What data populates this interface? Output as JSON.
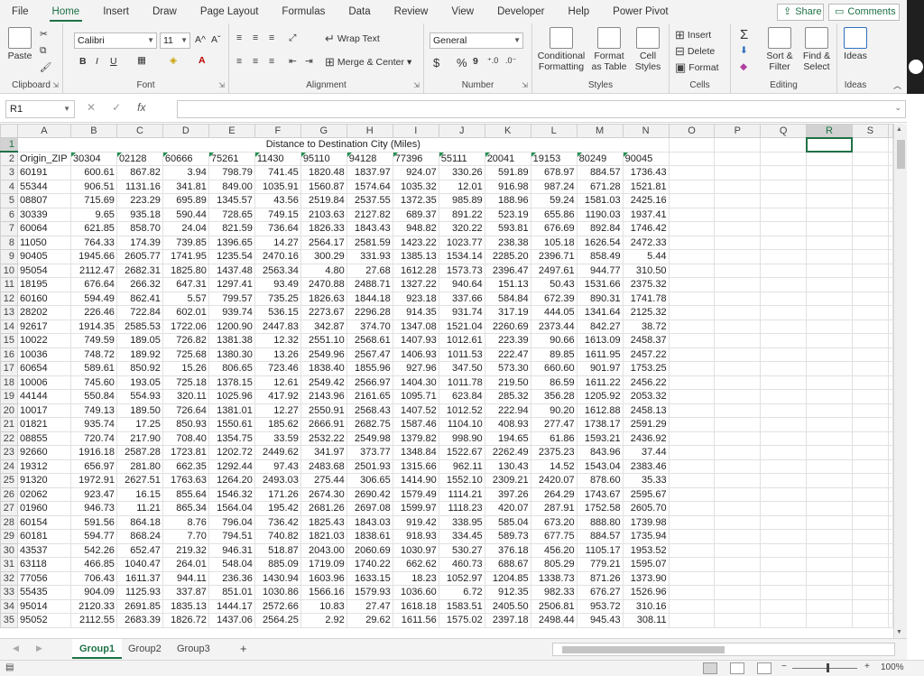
{
  "menu_tabs": [
    "File",
    "Home",
    "Insert",
    "Draw",
    "Page Layout",
    "Formulas",
    "Data",
    "Review",
    "View",
    "Developer",
    "Help",
    "Power Pivot"
  ],
  "share_label": "Share",
  "comments_label": "Comments",
  "ribbon": {
    "clipboard": {
      "label": "Clipboard",
      "paste": "Paste"
    },
    "font": {
      "label": "Font",
      "name": "Calibri",
      "size": "11",
      "grow": "A^",
      "shrink": "Aˇ",
      "bold": "B",
      "italic": "I",
      "underline": "U"
    },
    "alignment": {
      "label": "Alignment",
      "wrap": "Wrap Text",
      "merge": "Merge & Center"
    },
    "number": {
      "label": "Number",
      "format": "General",
      "currency": "$",
      "percent": "%",
      "comma": "9"
    },
    "styles": {
      "label": "Styles",
      "cond": "Conditional Formatting",
      "table": "Format as Table",
      "cell": "Cell Styles"
    },
    "cells": {
      "label": "Cells",
      "insert": "Insert",
      "delete": "Delete",
      "format": "Format"
    },
    "editing": {
      "label": "Editing",
      "sortfilter": "Sort & Filter",
      "findselect": "Find & Select",
      "sum": "Σ"
    },
    "ideas": {
      "label": "Ideas",
      "btn": "Ideas"
    }
  },
  "formula_bar": {
    "name_box": "R1",
    "cancel": "✕",
    "enter": "✓",
    "fx": "fx",
    "value": ""
  },
  "columns": [
    "A",
    "B",
    "C",
    "D",
    "E",
    "F",
    "G",
    "H",
    "I",
    "J",
    "K",
    "L",
    "M",
    "N",
    "O",
    "P",
    "Q",
    "R",
    "S"
  ],
  "selected_column": "R",
  "selected_row": 1,
  "title_cell": "Distance to Destination City (Miles)",
  "header_row": [
    "Origin_ZIP",
    "30304",
    "02128",
    "60666",
    "75261",
    "11430",
    "95110",
    "94128",
    "77396",
    "55111",
    "20041",
    "19153",
    "80249",
    "90045"
  ],
  "rows": [
    [
      "60191",
      "600.61",
      "867.82",
      "3.94",
      "798.79",
      "741.45",
      "1820.48",
      "1837.97",
      "924.07",
      "330.26",
      "591.89",
      "678.97",
      "884.57",
      "1736.43"
    ],
    [
      "55344",
      "906.51",
      "1131.16",
      "341.81",
      "849.00",
      "1035.91",
      "1560.87",
      "1574.64",
      "1035.32",
      "12.01",
      "916.98",
      "987.24",
      "671.28",
      "1521.81"
    ],
    [
      "08807",
      "715.69",
      "223.29",
      "695.89",
      "1345.57",
      "43.56",
      "2519.84",
      "2537.55",
      "1372.35",
      "985.89",
      "188.96",
      "59.24",
      "1581.03",
      "2425.16"
    ],
    [
      "30339",
      "9.65",
      "935.18",
      "590.44",
      "728.65",
      "749.15",
      "2103.63",
      "2127.82",
      "689.37",
      "891.22",
      "523.19",
      "655.86",
      "1190.03",
      "1937.41"
    ],
    [
      "60064",
      "621.85",
      "858.70",
      "24.04",
      "821.59",
      "736.64",
      "1826.33",
      "1843.43",
      "948.82",
      "320.22",
      "593.81",
      "676.69",
      "892.84",
      "1746.42"
    ],
    [
      "11050",
      "764.33",
      "174.39",
      "739.85",
      "1396.65",
      "14.27",
      "2564.17",
      "2581.59",
      "1423.22",
      "1023.77",
      "238.38",
      "105.18",
      "1626.54",
      "2472.33"
    ],
    [
      "90405",
      "1945.66",
      "2605.77",
      "1741.95",
      "1235.54",
      "2470.16",
      "300.29",
      "331.93",
      "1385.13",
      "1534.14",
      "2285.20",
      "2396.71",
      "858.49",
      "5.44"
    ],
    [
      "95054",
      "2112.47",
      "2682.31",
      "1825.80",
      "1437.48",
      "2563.34",
      "4.80",
      "27.68",
      "1612.28",
      "1573.73",
      "2396.47",
      "2497.61",
      "944.77",
      "310.50"
    ],
    [
      "18195",
      "676.64",
      "266.32",
      "647.31",
      "1297.41",
      "93.49",
      "2470.88",
      "2488.71",
      "1327.22",
      "940.64",
      "151.13",
      "50.43",
      "1531.66",
      "2375.32"
    ],
    [
      "60160",
      "594.49",
      "862.41",
      "5.57",
      "799.57",
      "735.25",
      "1826.63",
      "1844.18",
      "923.18",
      "337.66",
      "584.84",
      "672.39",
      "890.31",
      "1741.78"
    ],
    [
      "28202",
      "226.46",
      "722.84",
      "602.01",
      "939.74",
      "536.15",
      "2273.67",
      "2296.28",
      "914.35",
      "931.74",
      "317.19",
      "444.05",
      "1341.64",
      "2125.32"
    ],
    [
      "92617",
      "1914.35",
      "2585.53",
      "1722.06",
      "1200.90",
      "2447.83",
      "342.87",
      "374.70",
      "1347.08",
      "1521.04",
      "2260.69",
      "2373.44",
      "842.27",
      "38.72"
    ],
    [
      "10022",
      "749.59",
      "189.05",
      "726.82",
      "1381.38",
      "12.32",
      "2551.10",
      "2568.61",
      "1407.93",
      "1012.61",
      "223.39",
      "90.66",
      "1613.09",
      "2458.37"
    ],
    [
      "10036",
      "748.72",
      "189.92",
      "725.68",
      "1380.30",
      "13.26",
      "2549.96",
      "2567.47",
      "1406.93",
      "1011.53",
      "222.47",
      "89.85",
      "1611.95",
      "2457.22"
    ],
    [
      "60654",
      "589.61",
      "850.92",
      "15.26",
      "806.65",
      "723.46",
      "1838.40",
      "1855.96",
      "927.96",
      "347.50",
      "573.30",
      "660.60",
      "901.97",
      "1753.25"
    ],
    [
      "10006",
      "745.60",
      "193.05",
      "725.18",
      "1378.15",
      "12.61",
      "2549.42",
      "2566.97",
      "1404.30",
      "1011.78",
      "219.50",
      "86.59",
      "1611.22",
      "2456.22"
    ],
    [
      "44144",
      "550.84",
      "554.93",
      "320.11",
      "1025.96",
      "417.92",
      "2143.96",
      "2161.65",
      "1095.71",
      "623.84",
      "285.32",
      "356.28",
      "1205.92",
      "2053.32"
    ],
    [
      "10017",
      "749.13",
      "189.50",
      "726.64",
      "1381.01",
      "12.27",
      "2550.91",
      "2568.43",
      "1407.52",
      "1012.52",
      "222.94",
      "90.20",
      "1612.88",
      "2458.13"
    ],
    [
      "01821",
      "935.74",
      "17.25",
      "850.93",
      "1550.61",
      "185.62",
      "2666.91",
      "2682.75",
      "1587.46",
      "1104.10",
      "408.93",
      "277.47",
      "1738.17",
      "2591.29"
    ],
    [
      "08855",
      "720.74",
      "217.90",
      "708.40",
      "1354.75",
      "33.59",
      "2532.22",
      "2549.98",
      "1379.82",
      "998.90",
      "194.65",
      "61.86",
      "1593.21",
      "2436.92"
    ],
    [
      "92660",
      "1916.18",
      "2587.28",
      "1723.81",
      "1202.72",
      "2449.62",
      "341.97",
      "373.77",
      "1348.84",
      "1522.67",
      "2262.49",
      "2375.23",
      "843.96",
      "37.44"
    ],
    [
      "19312",
      "656.97",
      "281.80",
      "662.35",
      "1292.44",
      "97.43",
      "2483.68",
      "2501.93",
      "1315.66",
      "962.11",
      "130.43",
      "14.52",
      "1543.04",
      "2383.46"
    ],
    [
      "91320",
      "1972.91",
      "2627.51",
      "1763.63",
      "1264.20",
      "2493.03",
      "275.44",
      "306.65",
      "1414.90",
      "1552.10",
      "2309.21",
      "2420.07",
      "878.60",
      "35.33"
    ],
    [
      "02062",
      "923.47",
      "16.15",
      "855.64",
      "1546.32",
      "171.26",
      "2674.30",
      "2690.42",
      "1579.49",
      "1114.21",
      "397.26",
      "264.29",
      "1743.67",
      "2595.67"
    ],
    [
      "01960",
      "946.73",
      "11.21",
      "865.34",
      "1564.04",
      "195.42",
      "2681.26",
      "2697.08",
      "1599.97",
      "1118.23",
      "420.07",
      "287.91",
      "1752.58",
      "2605.70"
    ],
    [
      "60154",
      "591.56",
      "864.18",
      "8.76",
      "796.04",
      "736.42",
      "1825.43",
      "1843.03",
      "919.42",
      "338.95",
      "585.04",
      "673.20",
      "888.80",
      "1739.98"
    ],
    [
      "60181",
      "594.77",
      "868.24",
      "7.70",
      "794.51",
      "740.82",
      "1821.03",
      "1838.61",
      "918.93",
      "334.45",
      "589.73",
      "677.75",
      "884.57",
      "1735.94"
    ],
    [
      "43537",
      "542.26",
      "652.47",
      "219.32",
      "946.31",
      "518.87",
      "2043.00",
      "2060.69",
      "1030.97",
      "530.27",
      "376.18",
      "456.20",
      "1105.17",
      "1953.52"
    ],
    [
      "63118",
      "466.85",
      "1040.47",
      "264.01",
      "548.04",
      "885.09",
      "1719.09",
      "1740.22",
      "662.62",
      "460.73",
      "688.67",
      "805.29",
      "779.21",
      "1595.07"
    ],
    [
      "77056",
      "706.43",
      "1611.37",
      "944.11",
      "236.36",
      "1430.94",
      "1603.96",
      "1633.15",
      "18.23",
      "1052.97",
      "1204.85",
      "1338.73",
      "871.26",
      "1373.90"
    ],
    [
      "55435",
      "904.09",
      "1125.93",
      "337.87",
      "851.01",
      "1030.86",
      "1566.16",
      "1579.93",
      "1036.60",
      "6.72",
      "912.35",
      "982.33",
      "676.27",
      "1526.96"
    ],
    [
      "95014",
      "2120.33",
      "2691.85",
      "1835.13",
      "1444.17",
      "2572.66",
      "10.83",
      "27.47",
      "1618.18",
      "1583.51",
      "2405.50",
      "2506.81",
      "953.72",
      "310.16"
    ],
    [
      "95052",
      "2112.55",
      "2683.39",
      "1826.72",
      "1437.06",
      "2564.25",
      "2.92",
      "29.62",
      "1611.56",
      "1575.02",
      "2397.18",
      "2498.44",
      "945.43",
      "308.11"
    ]
  ],
  "sheet_tabs": [
    "Group1",
    "Group2",
    "Group3"
  ],
  "add_sheet": "+",
  "status": {
    "zoom": "100%",
    "minus": "−",
    "plus": "+"
  }
}
